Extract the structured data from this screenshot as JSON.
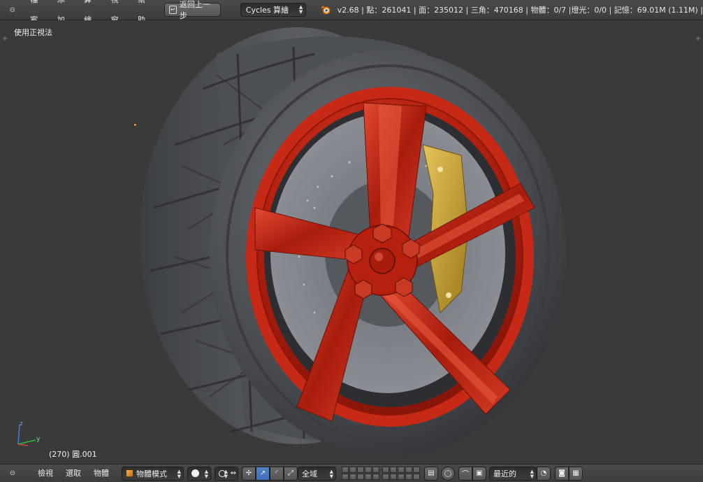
{
  "header": {
    "menu": [
      "檔案",
      "添加",
      "算繪",
      "視窗",
      "幫助"
    ],
    "undo_label": "返回上一步",
    "render_engine": "Cycles 算繪",
    "stats": "v2.68 | 點：261041 | 面：235012 | 三角：470168 | 物體：0/7 |燈光：0/0 | 記憶：69.01M (1.11M) |"
  },
  "viewport": {
    "view_label": "使用正視法",
    "object_info": "(270) 圓.001",
    "axis_labels": {
      "x": "x",
      "y": "y",
      "z": "z"
    }
  },
  "footer": {
    "menu": [
      "檢視",
      "選取",
      "物體"
    ],
    "mode": "物體模式",
    "transform_space": "全域",
    "snap_target": "最近的"
  },
  "colors": {
    "viewport_bg": "#3a3a3a",
    "rim_red": "#b5200f",
    "tire": "#4a4d52",
    "caliper": "#c8a033",
    "active_blue": "#3d6fbd"
  },
  "icons": [
    "blender-logo-icon",
    "undo-icon",
    "cube-icon",
    "solid-shading-icon",
    "pivot-icon",
    "manipulator-icon",
    "translate-icon",
    "rotate-icon",
    "scale-icon",
    "layers-icon",
    "proportional-edit-icon",
    "snap-icon",
    "render-icon",
    "clapper-icon"
  ]
}
